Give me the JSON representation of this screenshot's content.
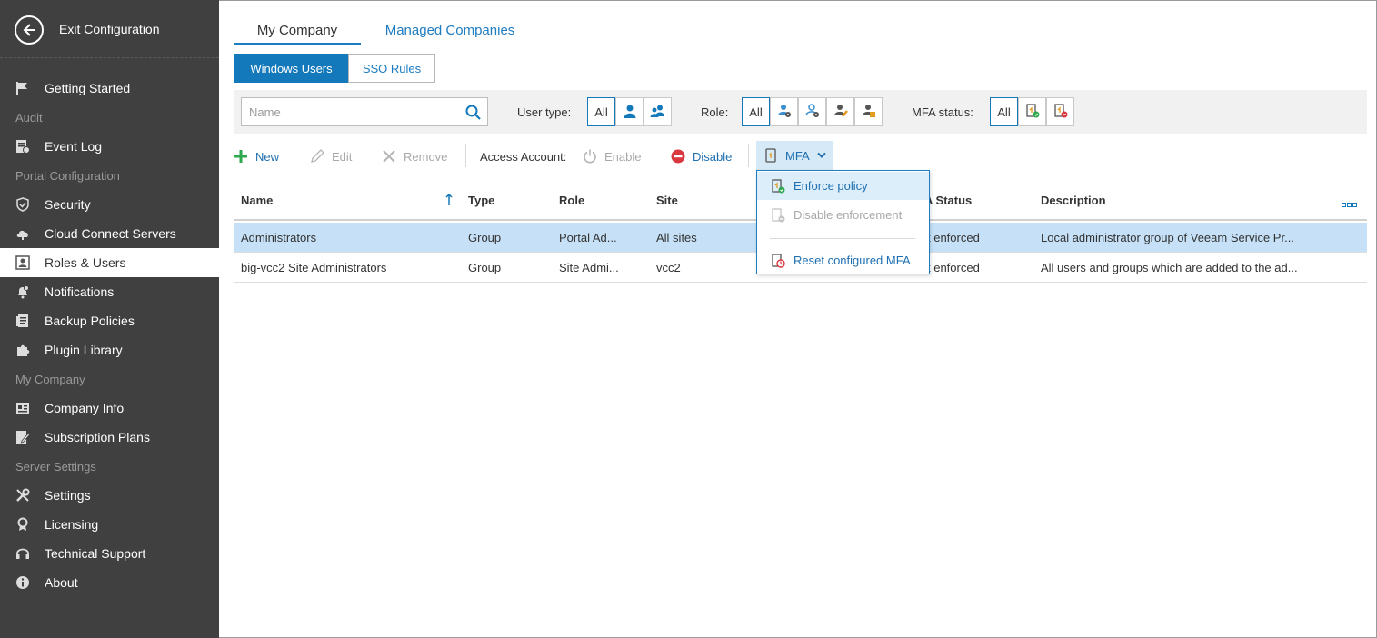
{
  "sidebar": {
    "exit_label": "Exit Configuration",
    "items": [
      {
        "label": "Getting Started",
        "icon": "flag-icon"
      },
      {
        "label": "Event Log",
        "icon": "event-log-icon"
      },
      {
        "label": "Security",
        "icon": "shield-icon"
      },
      {
        "label": "Cloud Connect Servers",
        "icon": "cloud-icon"
      },
      {
        "label": "Roles & Users",
        "icon": "user-card-icon",
        "active": true
      },
      {
        "label": "Notifications",
        "icon": "bell-icon"
      },
      {
        "label": "Backup Policies",
        "icon": "backup-policy-icon"
      },
      {
        "label": "Plugin Library",
        "icon": "puzzle-icon"
      },
      {
        "label": "Company Info",
        "icon": "company-info-icon"
      },
      {
        "label": "Subscription Plans",
        "icon": "subscription-icon"
      },
      {
        "label": "Settings",
        "icon": "wrench-icon"
      },
      {
        "label": "Licensing",
        "icon": "license-icon"
      },
      {
        "label": "Technical Support",
        "icon": "headset-icon"
      },
      {
        "label": "About",
        "icon": "info-icon"
      }
    ],
    "sections": {
      "audit": "Audit",
      "portal_configuration": "Portal Configuration",
      "my_company": "My Company",
      "server_settings": "Server Settings"
    }
  },
  "tabs": {
    "my_company": "My Company",
    "managed_companies": "Managed Companies"
  },
  "subtabs": {
    "windows_users": "Windows Users",
    "sso_rules": "SSO Rules"
  },
  "filters": {
    "search_placeholder": "Name",
    "user_type_label": "User type:",
    "role_label": "Role:",
    "mfa_status_label": "MFA status:",
    "all_label": "All"
  },
  "toolbar": {
    "new": "New",
    "edit": "Edit",
    "remove": "Remove",
    "access_account_label": "Access Account:",
    "enable": "Enable",
    "disable": "Disable",
    "mfa": "MFA"
  },
  "mfa_menu": {
    "enforce_policy": "Enforce policy",
    "disable_enforcement": "Disable enforcement",
    "reset_configured_mfa": "Reset configured MFA"
  },
  "table": {
    "columns": {
      "name": "Name",
      "type": "Type",
      "role": "Role",
      "site": "Site",
      "mfa_status": "A Status",
      "description": "Description"
    },
    "rows": [
      {
        "name": "Administrators",
        "type": "Group",
        "role": "Portal Ad...",
        "site": "All sites",
        "mfa_status": "t enforced",
        "description": "Local administrator group of Veeam Service Pr..."
      },
      {
        "name": "big-vcc2 Site Administrators",
        "type": "Group",
        "role": "Site Admi...",
        "site": "vcc2",
        "mfa_status": "t enforced",
        "description": "All users and groups which are added to the ad..."
      }
    ]
  },
  "colors": {
    "sidebar_bg": "#404040",
    "accent": "#1479bb",
    "selected_row": "#c6e1f7",
    "link": "#1e6fb1"
  }
}
